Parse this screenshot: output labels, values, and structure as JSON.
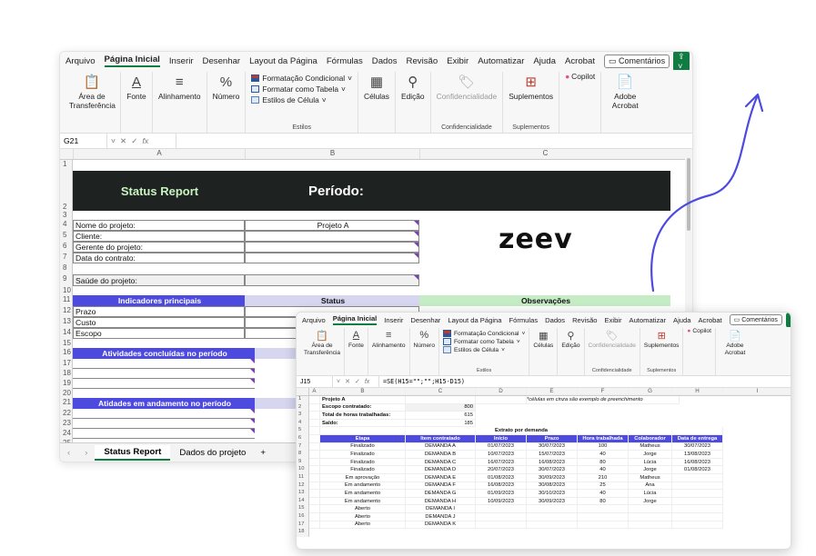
{
  "menu": [
    "Arquivo",
    "Página Inicial",
    "Inserir",
    "Desenhar",
    "Layout da Página",
    "Fórmulas",
    "Dados",
    "Revisão",
    "Exibir",
    "Automatizar",
    "Ajuda",
    "Acrobat"
  ],
  "comments_label": "Comentários",
  "ribbon": {
    "clipboard": "Área de Transferência",
    "font": "Fonte",
    "align": "Alinhamento",
    "number": "Número",
    "cond_format": "Formatação Condicional",
    "table_format": "Formatar como Tabela",
    "cell_styles": "Estilos de Célula",
    "styles_group": "Estilos",
    "cells": "Células",
    "edit": "Edição",
    "confidentiality": "Confidencialidade",
    "addins": "Suplementos",
    "copilot": "Copilot",
    "adobe": "Adobe Acrobat",
    "addins_group": "Suplementos",
    "conf_group": "Confidencialidade"
  },
  "sheet1": {
    "name_box": "G21",
    "col_headers": [
      "A",
      "B",
      "C"
    ],
    "title": "Status Report",
    "period_label": "Período:",
    "fields": [
      "Nome do projeto:",
      "Cliente:",
      "Gerente do projeto:",
      "Data do contrato:"
    ],
    "project_value": "Projeto A",
    "health_label": "Saúde do projeto:",
    "ind_header": "Indicadores principais",
    "status_header": "Status",
    "obs_header": "Observações",
    "indicators": [
      "Prazo",
      "Custo",
      "Escopo"
    ],
    "done_header": "Atividades concluídas no período",
    "ongoing_header": "Atidades em andamento no período",
    "tabs": [
      "Status Report",
      "Dados do projeto"
    ],
    "plus": "+"
  },
  "logo_text": "zeev",
  "sheet2": {
    "name_box": "J15",
    "formula": "=SE(H15=\"\";\"\";H15-D15)",
    "col_headers": [
      "A",
      "B",
      "C",
      "D",
      "E",
      "F",
      "G",
      "H",
      "I"
    ],
    "project": "Projeto A",
    "note": "*células em cinza são exemplo de preenchimento",
    "summary": [
      {
        "label": "Escopo contratado:",
        "value": "800"
      },
      {
        "label": "Total de horas trabalhadas:",
        "value": "615"
      },
      {
        "label": "Saldo:",
        "value": "185"
      }
    ],
    "table_title": "Extrato por demanda",
    "headers": [
      "Etapa",
      "Item contratado",
      "Início",
      "Prazo",
      "Hora trabalhada",
      "Colaborador",
      "Data de entrega"
    ],
    "rows": [
      [
        "Finalizado",
        "DEMANDA A",
        "01/07/2023",
        "30/07/2023",
        "100",
        "Matheus",
        "30/07/2023"
      ],
      [
        "Finalizado",
        "DEMANDA B",
        "10/07/2023",
        "15/07/2023",
        "40",
        "Jorge",
        "13/08/2023"
      ],
      [
        "Finalizado",
        "DEMANDA C",
        "16/07/2023",
        "16/08/2023",
        "80",
        "Lúcia",
        "16/08/2023"
      ],
      [
        "Finalizado",
        "DEMANDA D",
        "20/07/2023",
        "30/07/2023",
        "40",
        "Jorge",
        "01/08/2023"
      ],
      [
        "Em aprovação",
        "DEMANDA E",
        "01/08/2023",
        "30/09/2023",
        "210",
        "Matheus",
        ""
      ],
      [
        "Em andamento",
        "DEMANDA F",
        "16/08/2023",
        "30/08/2023",
        "25",
        "Ana",
        ""
      ],
      [
        "Em andamento",
        "DEMANDA G",
        "01/09/2023",
        "30/10/2023",
        "40",
        "Lúcia",
        ""
      ],
      [
        "Em andamento",
        "DEMANDA H",
        "10/09/2023",
        "30/09/2023",
        "80",
        "Jorge",
        ""
      ],
      [
        "Aberto",
        "DEMANDA I",
        "",
        "",
        "",
        "",
        ""
      ],
      [
        "Aberto",
        "DEMANDA J",
        "",
        "",
        "",
        "",
        ""
      ],
      [
        "Aberto",
        "DEMANDA K",
        "",
        "",
        "",
        "",
        ""
      ]
    ]
  },
  "colors": {
    "accent": "#4d4ae0",
    "dark_band": "#1e2220",
    "excel_green": "#107c41",
    "arrow": "#4d4ae0"
  }
}
